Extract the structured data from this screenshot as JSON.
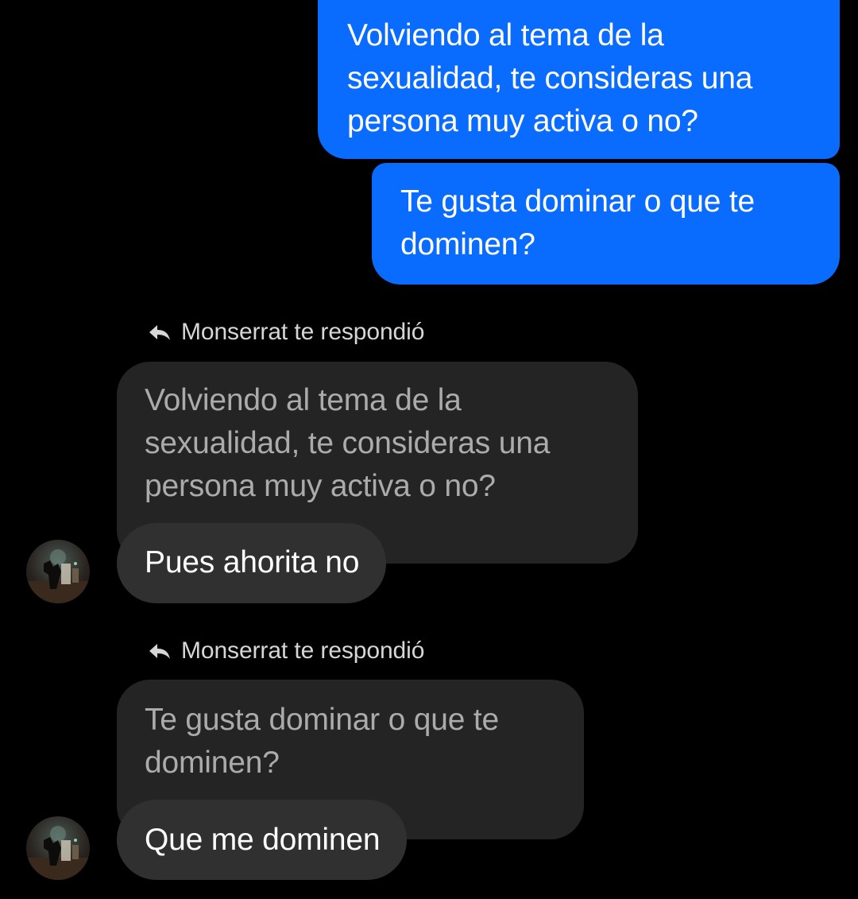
{
  "conversation": {
    "sent_messages": [
      {
        "lines": [
          "Volviendo al tema de la",
          "sexualidad, te consideras una",
          "persona muy activa o no?"
        ]
      },
      {
        "lines": [
          "Te gusta dominar o que te",
          "dominen?"
        ]
      }
    ],
    "replies": [
      {
        "header": "Monserrat te respondió",
        "reply_icon": "reply-arrow-icon",
        "quoted_lines": [
          "Volviendo al tema de la",
          "sexualidad, te consideras una",
          "persona muy activa o no?"
        ],
        "text": "Pues ahorita no",
        "avatar": "contact-avatar"
      },
      {
        "header": "Monserrat te respondió",
        "reply_icon": "reply-arrow-icon",
        "quoted_lines": [
          "Te gusta dominar o que te",
          "dominen?"
        ],
        "text": "Que me dominen",
        "avatar": "contact-avatar"
      }
    ]
  },
  "colors": {
    "background": "#000000",
    "sent_bubble": "#0A6CFF",
    "quoted_bubble": "#242424",
    "received_bubble": "#303030",
    "header_text": "#D6D6D6",
    "quoted_text": "#ABABAB"
  }
}
